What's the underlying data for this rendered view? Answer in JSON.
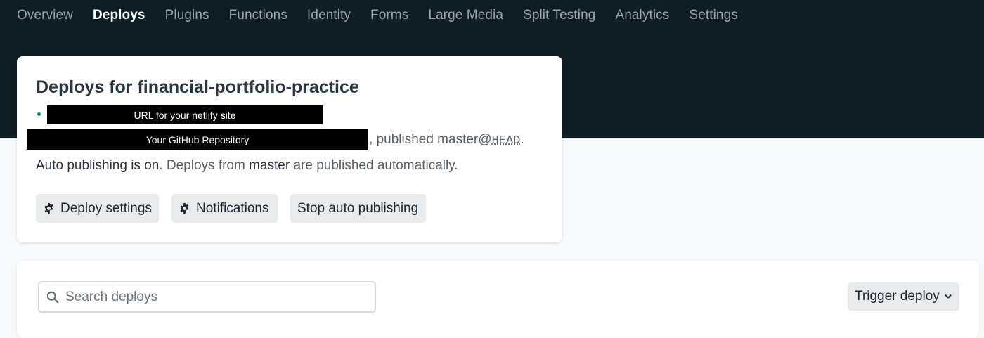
{
  "nav": {
    "tabs": [
      {
        "label": "Overview",
        "active": false
      },
      {
        "label": "Deploys",
        "active": true
      },
      {
        "label": "Plugins",
        "active": false
      },
      {
        "label": "Functions",
        "active": false
      },
      {
        "label": "Identity",
        "active": false
      },
      {
        "label": "Forms",
        "active": false
      },
      {
        "label": "Large Media",
        "active": false
      },
      {
        "label": "Split Testing",
        "active": false
      },
      {
        "label": "Analytics",
        "active": false
      },
      {
        "label": "Settings",
        "active": false
      }
    ]
  },
  "summary": {
    "title": "Deploys for financial-portfolio-practice",
    "url_redaction": "URL for your netlify site",
    "repo_redaction": "Your GitHub Repository",
    "published_prefix": ", published master@",
    "published_ref": "HEAD",
    "published_suffix": ".",
    "auto_label": "Auto publishing is on",
    "auto_mid": ". Deploys from ",
    "auto_branch": "master",
    "auto_end": " are published automatically.",
    "buttons": {
      "deploy_settings": "Deploy settings",
      "notifications": "Notifications",
      "stop_auto": "Stop auto publishing"
    }
  },
  "deploys": {
    "search_placeholder": "Search deploys",
    "search_value": "",
    "trigger_label": "Trigger deploy"
  },
  "icons": {
    "gear": "gear-icon",
    "search": "search-icon",
    "chevron": "chevron-down-icon"
  },
  "colors": {
    "header_bg": "#0e1e25",
    "accent_bullet": "#15847d",
    "button_bg": "#e8eaeb"
  }
}
